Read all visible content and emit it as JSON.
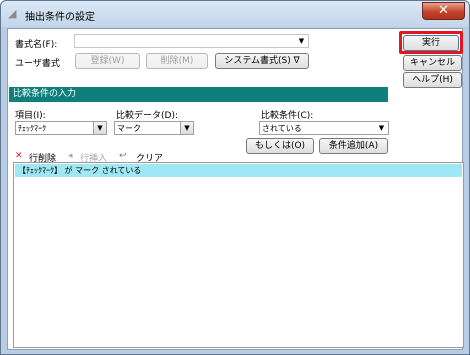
{
  "window": {
    "title": "抽出条件の設定",
    "close_glyph": "✕"
  },
  "form": {
    "format_name_label": "書式名(F):",
    "format_name_value": "",
    "user_format_label": "ユーザ書式",
    "register_label": "登録(W)",
    "delete_label": "削除(M)",
    "system_format_label": "システム書式(S) ∇"
  },
  "side_buttons": {
    "execute": "実行",
    "cancel": "キャンセル",
    "help": "ヘルプ(H)"
  },
  "section": {
    "title": "比較条件の入力"
  },
  "condition": {
    "item_label": "項目(I):",
    "item_value": "ﾁｪｯｸﾏｰｸ",
    "compare_data_label": "比較データ(D):",
    "compare_data_value": "マーク",
    "compare_cond_label": "比較条件(C):",
    "compare_cond_value": "されている",
    "or_button": "もしくは(O)",
    "add_button": "条件追加(A)"
  },
  "toolbar": {
    "delete_row_icon": "✕",
    "delete_row": "行削除",
    "insert_row_icon": "◂",
    "insert_row": "行挿入",
    "clear_icon": "↩",
    "clear": "クリア"
  },
  "list": {
    "rows": [
      "【ﾁｪｯｸﾏｰｸ】 が マーク されている"
    ]
  }
}
